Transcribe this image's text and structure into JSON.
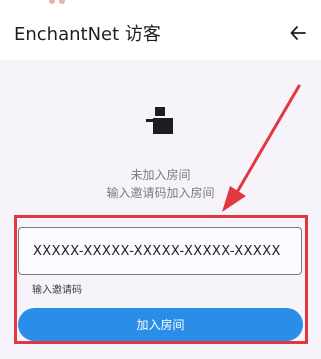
{
  "app_bar": {
    "title": "EnchantNet 访客",
    "back_icon": "arrow-left-icon"
  },
  "empty_state": {
    "icon": "empty-inbox-icon",
    "title": "未加入房间",
    "hint": "输入邀请码加入房间"
  },
  "invite_form": {
    "invite_code_value": "XXXXX-XXXXX-XXXXX-XXXXX-XXXXX",
    "invite_code_helper": "输入邀请码",
    "join_button_label": "加入房间"
  },
  "annotation": {
    "color": "#e0383f"
  },
  "colors": {
    "accent": "#2a8ee8",
    "background": "#f6f4fa"
  }
}
